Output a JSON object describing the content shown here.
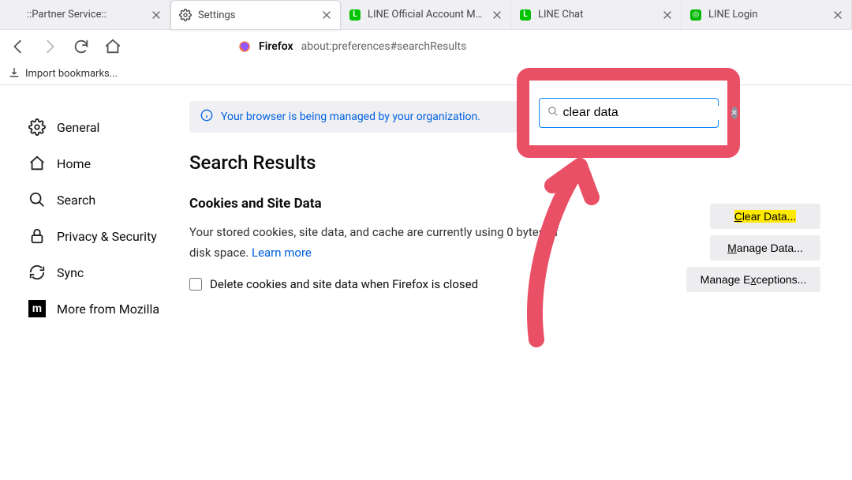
{
  "tabs": [
    {
      "label": "::Partner Service::",
      "icon": "blank"
    },
    {
      "label": "Settings",
      "icon": "gear"
    },
    {
      "label": "LINE Official Account Manager",
      "icon": "line-l"
    },
    {
      "label": "LINE Chat",
      "icon": "line-l"
    },
    {
      "label": "LINE Login",
      "icon": "line-square"
    }
  ],
  "active_tab_index": 1,
  "url": {
    "host": "Firefox",
    "path": "about:preferences#searchResults"
  },
  "bookmarks_bar": {
    "import_label": "Import bookmarks..."
  },
  "sidebar": {
    "items": [
      {
        "label": "General"
      },
      {
        "label": "Home"
      },
      {
        "label": "Search"
      },
      {
        "label": "Privacy & Security"
      },
      {
        "label": "Sync"
      },
      {
        "label": "More from Mozilla"
      }
    ]
  },
  "banner": {
    "text": "Your browser is being managed by your organization."
  },
  "search": {
    "value": "clear data"
  },
  "page_title": "Search Results",
  "cookies_section": {
    "title": "Cookies and Site Data",
    "body_pre": "Your stored cookies, site data, and cache are currently using 0 bytes of disk space.   ",
    "learn_more": "Learn more",
    "checkbox_label": "Delete cookies and site data when Firefox is closed"
  },
  "buttons": {
    "clear_data_prefix_hl": "C",
    "clear_data_rest": "lear Data...",
    "manage_data_u": "M",
    "manage_data_rest": "anage Data...",
    "manage_exceptions_pre": "Manage E",
    "manage_exceptions_u": "x",
    "manage_exceptions_rest": "ceptions..."
  }
}
